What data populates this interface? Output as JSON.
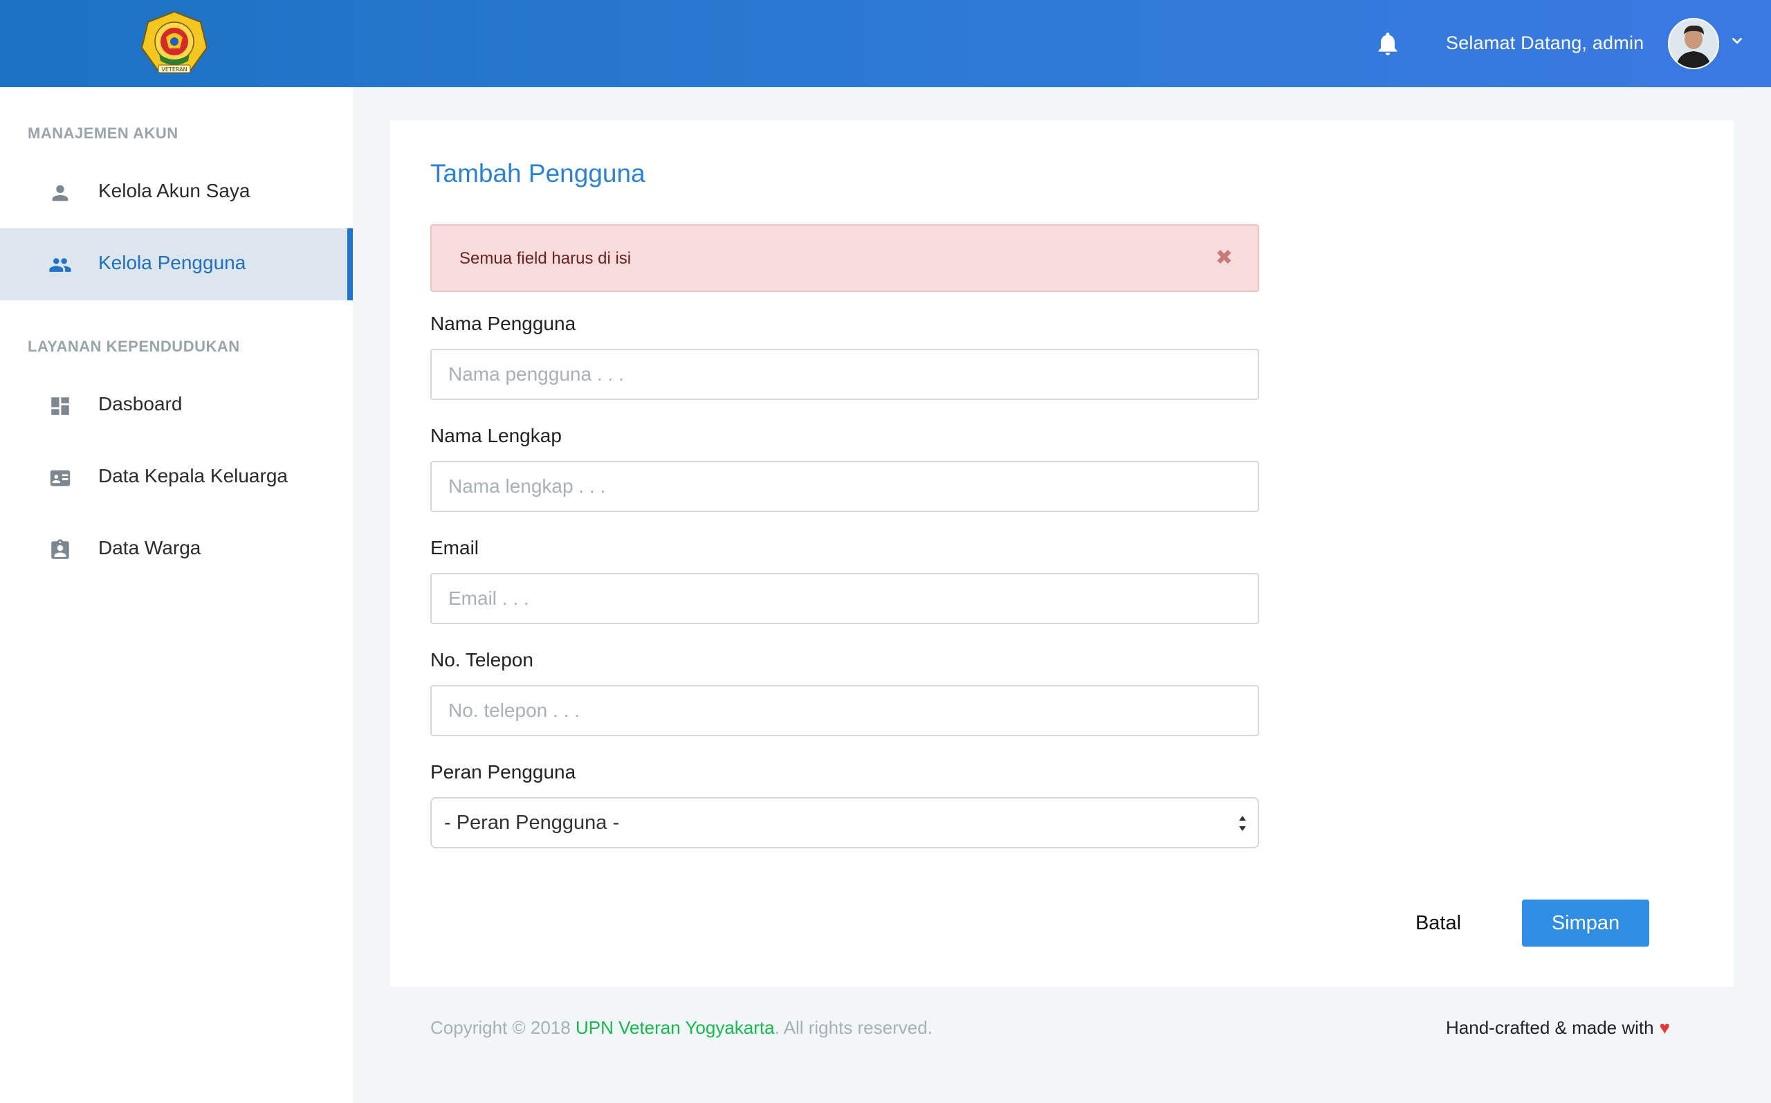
{
  "header": {
    "welcome": "Selamat Datang, admin",
    "logo_text": "VETERAN",
    "icons": {
      "notification": "bell-icon",
      "profile_menu": "chevron-down-icon"
    }
  },
  "sidebar": {
    "sections": [
      {
        "title": "MANAJEMEN AKUN",
        "items": [
          {
            "label": "Kelola Akun Saya",
            "icon": "person-icon",
            "active": false
          },
          {
            "label": "Kelola Pengguna",
            "icon": "people-icon",
            "active": true
          }
        ]
      },
      {
        "title": "LAYANAN KEPENDUDUKAN",
        "items": [
          {
            "label": "Dasboard",
            "icon": "dashboard-icon",
            "active": false
          },
          {
            "label": "Data Kepala Keluarga",
            "icon": "id-card-icon",
            "active": false
          },
          {
            "label": "Data Warga",
            "icon": "clipboard-user-icon",
            "active": false
          }
        ]
      }
    ]
  },
  "form": {
    "title": "Tambah Pengguna",
    "alert": "Semua field harus di isi",
    "fields": [
      {
        "label": "Nama Pengguna",
        "placeholder": "Nama pengguna . . .",
        "value": ""
      },
      {
        "label": "Nama Lengkap",
        "placeholder": "Nama lengkap . . .",
        "value": ""
      },
      {
        "label": "Email",
        "placeholder": "Email . . .",
        "value": ""
      },
      {
        "label": "No. Telepon",
        "placeholder": "No. telepon . . .",
        "value": ""
      }
    ],
    "role": {
      "label": "Peran Pengguna",
      "selected": "- Peran Pengguna -"
    },
    "cancel": "Batal",
    "save": "Simpan"
  },
  "footer": {
    "copyright_prefix": "Copyright © 2018 ",
    "brand": "UPN Veteran Yogyakarta",
    "copyright_suffix": ". All rights reserved.",
    "made_with": "Hand-crafted & made with"
  },
  "colors": {
    "header_gradient_start": "#1c72c4",
    "header_gradient_end": "#3b79e3",
    "accent": "#2b82d4",
    "primary_button": "#2f8ee3",
    "alert_background": "#f8dcdc",
    "brand_green": "#19b84c",
    "heart": "#e53935"
  }
}
